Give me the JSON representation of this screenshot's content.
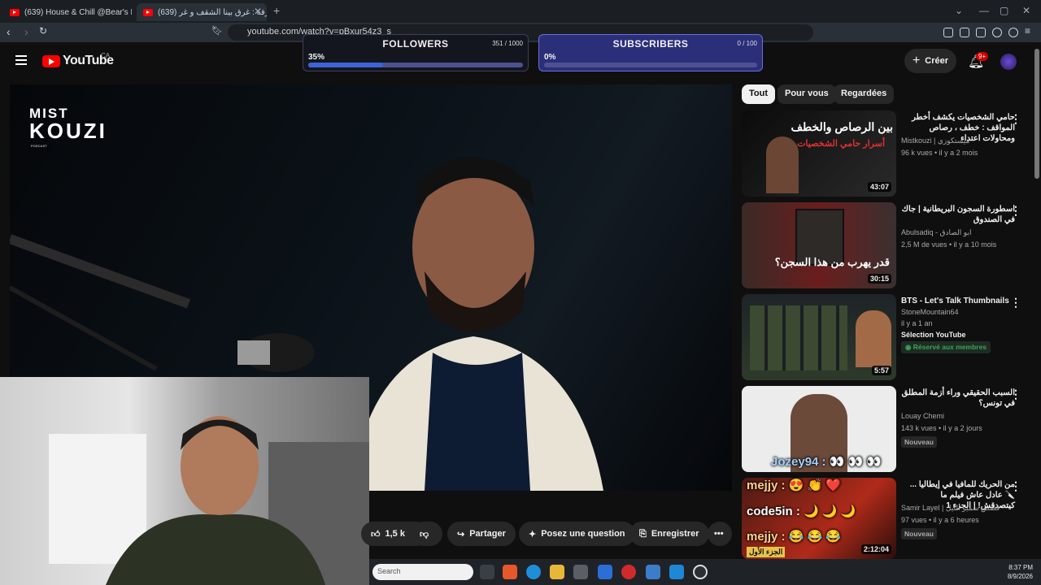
{
  "browser": {
    "tabs": [
      {
        "title": "(639) House & Chill @Bear's Den | Fe"
      },
      {
        "title": "(639) الحرقة : غرق بينا الشقف و غر"
      }
    ],
    "url": "youtube.com/watch?v=pBxur54z3_s"
  },
  "youtube": {
    "logo": "YouTube",
    "region": "CA",
    "create_label": "Créer",
    "notif_badge": "9+"
  },
  "goals": {
    "followers": {
      "title": "FOLLOWERS",
      "count": "351 / 1000",
      "percent_label": "35%",
      "progress": 0.35
    },
    "subscribers": {
      "title": "SUBSCRIBERS",
      "count": "0 / 100",
      "percent_label": "0%",
      "progress": 0.0
    }
  },
  "video": {
    "logo_line1": "MIST",
    "logo_line2": "KOUZI",
    "logo_line3": "PODCAST"
  },
  "actions": {
    "likes": "1,5 k",
    "share": "Partager",
    "ask": "Posez une question",
    "save": "Enregistrer"
  },
  "filters": [
    "Tout",
    "Pour vous",
    "Regardées"
  ],
  "recommendations": [
    {
      "title": "حامي الشخصيات يكشف أخطر المواقف : خطف ، رصاص ومحاولات اعتداء",
      "channel": "Mistkouzi | ميستكوزي",
      "meta": "96 k vues • il y a 2 mois",
      "duration": "43:07",
      "thumb_text": "بين الرصاص والخطف",
      "thumb_sub": "أسرار حامي الشخصيات"
    },
    {
      "title": "اسطورة السجون البريطانية | جاك في الصندوق",
      "channel": "Abulsadiq - ابو الصادق",
      "meta": "2,5 M de vues • il y a 10 mois",
      "duration": "30:15",
      "thumb_text": "قدر يهرب من هذا السجن؟"
    },
    {
      "title": "BTS - Let's Talk Thumbnails",
      "channel": "StoneMountain64",
      "meta": "il y a 1 an",
      "extra": "Sélection YouTube",
      "members": "Réservé aux membres",
      "duration": "5:57"
    },
    {
      "title": "السبب الحقيقي وراء أزمة المطلق في تونس؟",
      "channel": "Louay Chemi",
      "meta": "143 k vues • il y a 2 jours",
      "badge": "Nouveau",
      "duration": ""
    },
    {
      "title": "من الحريك للمافيا في إيطاليا ...🔪 عادل عاش فيلم ما كيتصدقش! | الجزء 1",
      "channel": "Samir Layel | قصص سمير الليل",
      "meta": "97 vues • il y a 6 heures",
      "badge": "Nouveau",
      "duration": "2:12:04",
      "thumb_text": "الجزء الأول"
    }
  ],
  "chat": [
    {
      "user": "Jozey94",
      "msg": "👀 👀 👀"
    },
    {
      "user": "mejjy",
      "msg": "😍 👏 ❤️"
    },
    {
      "user": "code5in",
      "msg": "🌙 🌙 🌙"
    },
    {
      "user": "mejjy",
      "msg": "😂 😂 😂"
    }
  ],
  "taskbar": {
    "search_placeholder": "Search",
    "time": "8:37 PM",
    "date": "8/9/2026"
  },
  "colors": {
    "accent_red": "#ff0000",
    "goal_fill": "#3c64d8",
    "members_green": "#3ea35a"
  }
}
